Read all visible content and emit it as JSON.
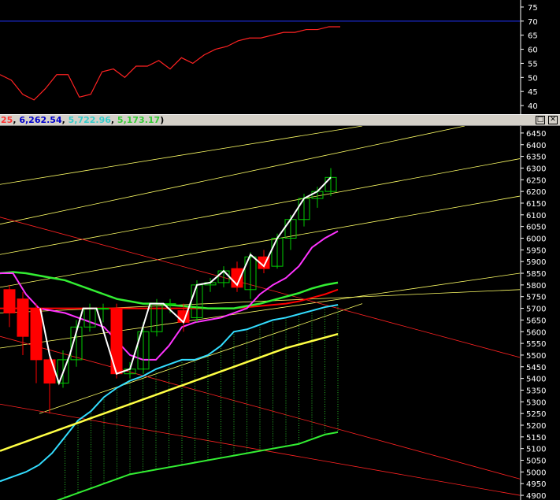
{
  "header": {
    "values": [
      {
        "text": "25",
        "color": "#ff3333"
      },
      {
        "text": ", ",
        "color": "#000000"
      },
      {
        "text": "6,262.54",
        "color": "#0000cc"
      },
      {
        "text": ", ",
        "color": "#000000"
      },
      {
        "text": "5,722.96",
        "color": "#33cccc"
      },
      {
        "text": ", ",
        "color": "#000000"
      },
      {
        "text": "5,173.17",
        "color": "#33cc33"
      },
      {
        "text": ")",
        "color": "#000000"
      }
    ],
    "restore_glyph": "□",
    "close_glyph": "✕"
  },
  "colors": {
    "background": "#000000",
    "candle_up": "#00cc00",
    "candle_down": "#ff0000",
    "price_line": "#ffffff",
    "ma_magenta": "#ff33ff",
    "ma_green": "#33ee33",
    "ma_red": "#ff0000",
    "ma_yellow": "#ffff44",
    "band_upper": "#33ddff",
    "band_lower": "#33ee33",
    "trend_yellow": "#ffff66",
    "trend_red": "#ff2222",
    "rsi_line": "#ff2222",
    "rsi_level": "#2233ff",
    "axis_text": "#ffffff"
  },
  "chart_data": [
    {
      "type": "line",
      "name": "oscillator",
      "y_ticks": [
        75,
        70,
        65,
        60,
        55,
        50,
        45,
        40
      ],
      "ylim": [
        37.5,
        77.5
      ],
      "level": 70,
      "x": [
        0,
        1,
        2,
        3,
        4,
        5,
        6,
        7,
        8,
        9,
        10,
        11,
        12,
        13,
        14,
        15,
        16,
        17,
        18,
        19,
        20,
        21,
        22,
        23,
        24,
        25,
        26,
        27,
        28,
        29,
        30
      ],
      "values": [
        51,
        49,
        44,
        42,
        46,
        51,
        51,
        43,
        44,
        52,
        53,
        50,
        54,
        54,
        56,
        53,
        57,
        55,
        58,
        60,
        61,
        63,
        64,
        64,
        65,
        66,
        66,
        67,
        67,
        68,
        68
      ]
    },
    {
      "type": "candlestick",
      "name": "price",
      "y_ticks": [
        6450,
        6400,
        6350,
        6300,
        6250,
        6200,
        6150,
        6100,
        6050,
        6000,
        5950,
        5900,
        5850,
        5800,
        5750,
        5700,
        5650,
        5600,
        5550,
        5500,
        5450,
        5400,
        5350,
        5300,
        5250,
        5200,
        5150,
        5100,
        5050,
        5000,
        4950,
        4900
      ],
      "ylim": [
        4880,
        6480
      ],
      "candles": [
        {
          "x": 0,
          "open": 5780,
          "close": 5680,
          "high": 5800,
          "low": 5620
        },
        {
          "x": 1,
          "open": 5740,
          "close": 5580,
          "high": 5770,
          "low": 5500
        },
        {
          "x": 2,
          "open": 5700,
          "close": 5480,
          "high": 5720,
          "low": 5380
        },
        {
          "x": 3,
          "open": 5480,
          "close": 5380,
          "high": 5500,
          "low": 5250
        },
        {
          "x": 4,
          "open": 5380,
          "close": 5480,
          "high": 5520,
          "low": 5360
        },
        {
          "x": 5,
          "open": 5480,
          "close": 5620,
          "high": 5650,
          "low": 5450
        },
        {
          "x": 6,
          "open": 5620,
          "close": 5700,
          "high": 5720,
          "low": 5600
        },
        {
          "x": 7,
          "open": 5700,
          "close": 5700,
          "high": 5720,
          "low": 5640
        },
        {
          "x": 8,
          "open": 5700,
          "close": 5420,
          "high": 5720,
          "low": 5400
        },
        {
          "x": 9,
          "open": 5420,
          "close": 5440,
          "high": 5470,
          "low": 5400
        },
        {
          "x": 10,
          "open": 5440,
          "close": 5600,
          "high": 5640,
          "low": 5420
        },
        {
          "x": 11,
          "open": 5600,
          "close": 5720,
          "high": 5740,
          "low": 5580
        },
        {
          "x": 12,
          "open": 5720,
          "close": 5720,
          "high": 5740,
          "low": 5680
        },
        {
          "x": 13,
          "open": 5690,
          "close": 5640,
          "high": 5720,
          "low": 5600
        },
        {
          "x": 14,
          "open": 5660,
          "close": 5800,
          "high": 5820,
          "low": 5640
        },
        {
          "x": 15,
          "open": 5800,
          "close": 5810,
          "high": 5830,
          "low": 5770
        },
        {
          "x": 16,
          "open": 5810,
          "close": 5860,
          "high": 5880,
          "low": 5790
        },
        {
          "x": 17,
          "open": 5870,
          "close": 5790,
          "high": 5900,
          "low": 5770
        },
        {
          "x": 18,
          "open": 5780,
          "close": 5920,
          "high": 5940,
          "low": 5740
        },
        {
          "x": 19,
          "open": 5920,
          "close": 5870,
          "high": 5950,
          "low": 5850
        },
        {
          "x": 20,
          "open": 5880,
          "close": 6000,
          "high": 6020,
          "low": 5870
        },
        {
          "x": 21,
          "open": 6000,
          "close": 6080,
          "high": 6100,
          "low": 5950
        },
        {
          "x": 22,
          "open": 6080,
          "close": 6170,
          "high": 6190,
          "low": 6050
        },
        {
          "x": 23,
          "open": 6170,
          "close": 6200,
          "high": 6220,
          "low": 6130
        },
        {
          "x": 24,
          "open": 6200,
          "close": 6260,
          "high": 6300,
          "low": 6180
        }
      ],
      "close_line": [
        5700,
        5500,
        5380,
        5500,
        5700,
        5700,
        5420,
        5440,
        5720,
        5720,
        5640,
        5800,
        5810,
        5860,
        5800,
        5930,
        5880,
        6000,
        6080,
        6170,
        6200,
        6260
      ],
      "close_line_x": [
        2.3,
        3,
        3.7,
        4.5,
        5.5,
        6.5,
        8,
        9,
        10.5,
        11.5,
        13,
        14,
        15,
        16,
        17,
        18,
        19,
        20,
        21,
        22,
        23,
        24
      ],
      "ma_magenta": [
        5850,
        5850,
        5760,
        5700,
        5690,
        5680,
        5660,
        5640,
        5620,
        5560,
        5500,
        5480,
        5480,
        5540,
        5620,
        5640,
        5650,
        5660,
        5680,
        5700,
        5760,
        5800,
        5830,
        5880,
        5960,
        6000,
        6030
      ],
      "ma_green": [
        5850,
        5855,
        5850,
        5840,
        5830,
        5820,
        5800,
        5780,
        5760,
        5740,
        5730,
        5720,
        5720,
        5715,
        5710,
        5705,
        5700,
        5700,
        5700,
        5710,
        5720,
        5735,
        5750,
        5765,
        5785,
        5800,
        5810
      ],
      "ma_red": [
        5700,
        5700,
        5700,
        5700,
        5700,
        5700,
        5700,
        5700,
        5700,
        5700,
        5700,
        5700,
        5700,
        5700,
        5700,
        5700,
        5700,
        5700,
        5700,
        5705,
        5710,
        5715,
        5720,
        5730,
        5745,
        5760,
        5780
      ],
      "ma_yellow": [
        5090,
        5110,
        5130,
        5150,
        5170,
        5190,
        5210,
        5230,
        5250,
        5270,
        5290,
        5310,
        5330,
        5350,
        5370,
        5390,
        5410,
        5430,
        5450,
        5470,
        5490,
        5510,
        5530,
        5545,
        5560,
        5575,
        5590
      ],
      "band_upper": [
        4960,
        4980,
        5000,
        5030,
        5080,
        5150,
        5220,
        5260,
        5320,
        5360,
        5390,
        5410,
        5440,
        5460,
        5480,
        5480,
        5500,
        5540,
        5600,
        5610,
        5630,
        5650,
        5660,
        5675,
        5690,
        5705,
        5715
      ],
      "band_lower": [
        4800,
        4810,
        4830,
        4850,
        4870,
        4890,
        4910,
        4930,
        4950,
        4970,
        4990,
        5000,
        5010,
        5020,
        5030,
        5040,
        5050,
        5060,
        5070,
        5080,
        5090,
        5100,
        5110,
        5120,
        5140,
        5160,
        5170
      ]
    }
  ]
}
